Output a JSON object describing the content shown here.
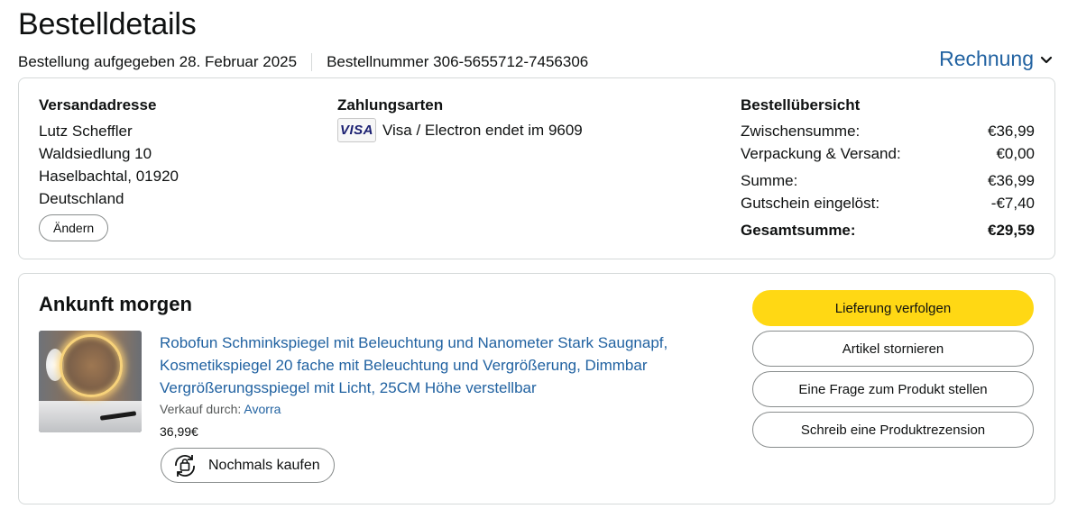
{
  "header": {
    "title": "Bestelldetails",
    "order_date": "Bestellung aufgegeben 28. Februar 2025",
    "order_number": "Bestellnummer 306-5655712-7456306",
    "invoice_label": "Rechnung"
  },
  "shipping": {
    "heading": "Versandadresse",
    "lines": [
      "Lutz Scheffler",
      "Waldsiedlung 10",
      "Haselbachtal, 01920",
      "Deutschland"
    ],
    "change_label": "Ändern"
  },
  "payment": {
    "heading": "Zahlungsarten",
    "card_logo": "VISA",
    "card_text": "Visa / Electron endet im 9609"
  },
  "summary": {
    "heading": "Bestellübersicht",
    "rows": [
      {
        "label": "Zwischensumme:",
        "value": "€36,99"
      },
      {
        "label": "Verpackung & Versand:",
        "value": "€0,00"
      },
      {
        "label": "Summe:",
        "value": "€36,99"
      },
      {
        "label": "Gutschein eingelöst:",
        "value": "-€7,40"
      },
      {
        "label": "Gesamtsumme:",
        "value": "€29,59"
      }
    ]
  },
  "shipment": {
    "status": "Ankunft morgen",
    "product_title": "Robofun Schminkspiegel mit Beleuchtung und Nanometer Stark Saugnapf, Kosmetikspiegel 20 fache mit Beleuchtung und Vergrößerung, Dimmbar Vergrößerungsspiegel mit Licht, 25CM Höhe verstellbar",
    "seller_prefix": "Verkauf durch:",
    "seller_name": "Avorra",
    "price": "36,99€",
    "buy_again_label": "Nochmals kaufen"
  },
  "actions": {
    "track": "Lieferung verfolgen",
    "cancel": "Artikel stornieren",
    "question": "Eine Frage zum Produkt stellen",
    "review": "Schreib eine Produktrezension"
  },
  "colors": {
    "link": "#2162a1",
    "primary_button": "#ffd814",
    "border": "#d5d9d9"
  }
}
